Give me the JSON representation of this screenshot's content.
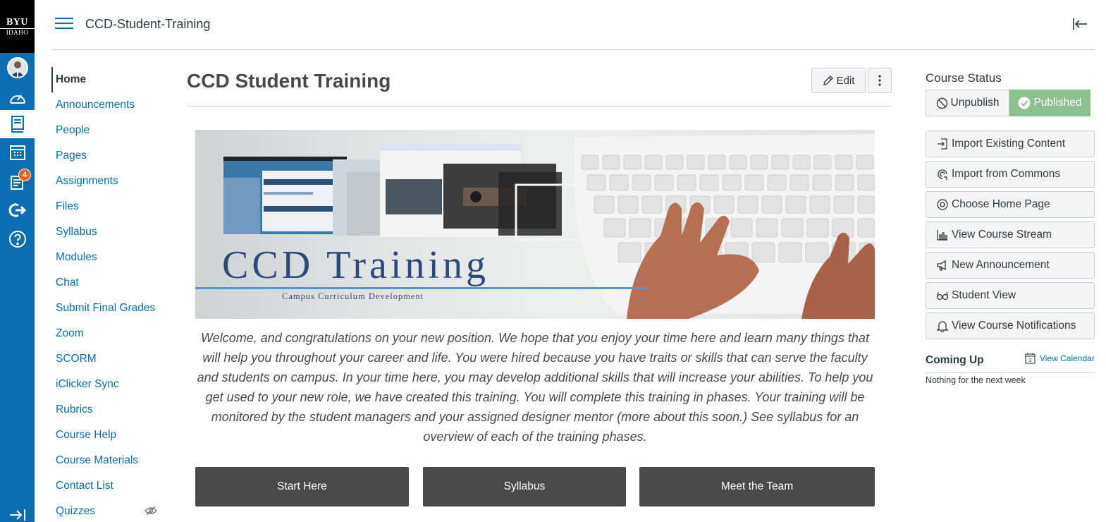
{
  "logo": {
    "line1": "BYU",
    "line2": "IDAHO"
  },
  "global_nav": {
    "inbox_badge": "4"
  },
  "header": {
    "breadcrumb": "CCD-Student-Training"
  },
  "course_nav": {
    "items": [
      "Home",
      "Announcements",
      "People",
      "Pages",
      "Assignments",
      "Files",
      "Syllabus",
      "Modules",
      "Chat",
      "Submit Final Grades",
      "Zoom",
      "SCORM",
      "iClicker Sync",
      "Rubrics",
      "Course Help",
      "Course Materials",
      "Contact List",
      "Quizzes"
    ],
    "active": "Home"
  },
  "main": {
    "title": "CCD Student Training",
    "edit_label": "Edit",
    "banner": {
      "title": "CCD Training",
      "subtitle": "Campus Curriculum Development"
    },
    "welcome": "Welcome, and congratulations on your new position. We hope that you enjoy your time here and learn many things that will help you throughout your career and life. You were hired because you have traits or skills that can serve the faculty and students on campus. In your time here, you may develop additional skills that will increase your abilities. To help you get used to your new role, we have created this training. You will complete this training in phases. Your training will be monitored by the student managers and your assigned designer mentor (more about this soon.) See syllabus for an overview of each of the training phases.",
    "buttons": [
      "Start Here",
      "Syllabus",
      "Meet the Team"
    ]
  },
  "sidebar": {
    "course_status_title": "Course Status",
    "unpublish_label": "Unpublish",
    "published_label": "Published",
    "actions": [
      "Import Existing Content",
      "Import from Commons",
      "Choose Home Page",
      "View Course Stream",
      "New Announcement",
      "Student View",
      "View Course Notifications"
    ],
    "coming_up_title": "Coming Up",
    "view_calendar_label": "View Calendar",
    "calendar_day": "3",
    "coming_up_empty": "Nothing for the next week"
  },
  "colors": {
    "nav_blue": "#0a6eb4",
    "link": "#0770a3",
    "published_green": "#8cc08c",
    "cta_dark": "#4a4a4a",
    "badge_orange": "#fc5e13"
  }
}
